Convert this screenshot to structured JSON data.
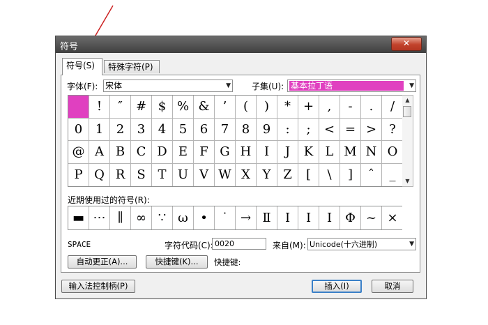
{
  "window": {
    "title": "符号",
    "close_label": "✕"
  },
  "tabs": [
    {
      "label": "符号(S)",
      "active": true
    },
    {
      "label": "特殊字符(P)",
      "active": false
    }
  ],
  "font": {
    "label": "字体(F):",
    "value": "宋体"
  },
  "subset": {
    "label": "子集(U):",
    "value": "基本拉丁语"
  },
  "symbol_grid": [
    [
      "",
      "!",
      "″",
      "#",
      "$",
      "%",
      "&",
      "’",
      "(",
      ")",
      "*",
      "+",
      ",",
      "-",
      ".",
      "/"
    ],
    [
      "0",
      "1",
      "2",
      "3",
      "4",
      "5",
      "6",
      "7",
      "8",
      "9",
      ":",
      ";",
      "<",
      "=",
      ">",
      "?"
    ],
    [
      "@",
      "A",
      "B",
      "C",
      "D",
      "E",
      "F",
      "G",
      "H",
      "I",
      "J",
      "K",
      "L",
      "M",
      "N",
      "O"
    ],
    [
      "P",
      "Q",
      "R",
      "S",
      "T",
      "U",
      "V",
      "W",
      "X",
      "Y",
      "Z",
      "[",
      "\\",
      "]",
      "ˆ",
      "_"
    ]
  ],
  "recent": {
    "label": "近期使用过的符号(R):",
    "symbols": [
      "▬",
      "⋯",
      "∥",
      "∞",
      "∵",
      "ω",
      "•",
      "˙",
      "→",
      "Ⅱ",
      "Ⅰ",
      "Ⅰ",
      "Ⅰ",
      "Φ",
      "~",
      "×"
    ]
  },
  "char_name": "SPACE",
  "char_code": {
    "label": "字符代码(C):",
    "value": "0020"
  },
  "from": {
    "label": "来自(M):",
    "value": "Unicode(十六进制)"
  },
  "buttons": {
    "autocorrect": "自动更正(A)...",
    "shortcut": "快捷键(K)...",
    "shortcut_label": "快捷键:",
    "ime": "输入法控制柄(P)",
    "insert": "插入(I)",
    "cancel": "取消"
  },
  "colors": {
    "selected": "#e040c0",
    "arrow": "#cc2222"
  }
}
